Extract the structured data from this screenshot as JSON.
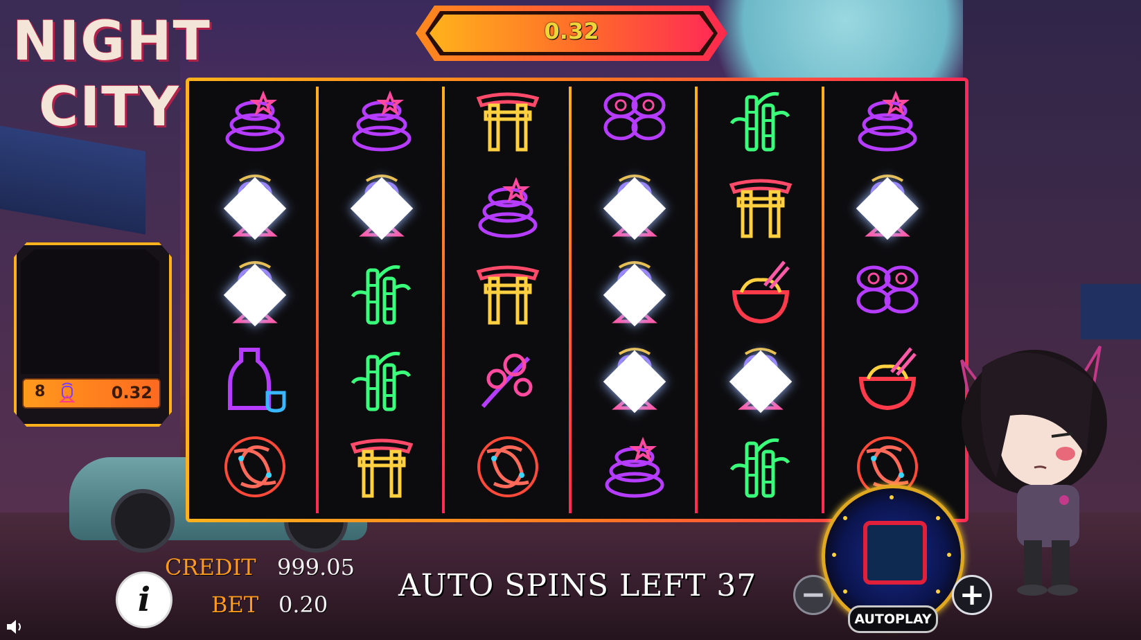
{
  "game": {
    "logo_line1": "NIGHT",
    "logo_line2": "CITY"
  },
  "win_display": {
    "value": "0.32"
  },
  "reels": [
    [
      "stones",
      "lantern",
      "lantern",
      "sake",
      "koi"
    ],
    [
      "stones",
      "lantern",
      "bamboo",
      "bamboo",
      "torii"
    ],
    [
      "torii",
      "stones",
      "torii",
      "blossom",
      "koi"
    ],
    [
      "sushi",
      "lantern",
      "lantern",
      "lantern",
      "stones"
    ],
    [
      "bamboo",
      "torii",
      "noodles",
      "lantern",
      "bamboo"
    ],
    [
      "stones",
      "lantern",
      "sushi",
      "noodles",
      "koi"
    ]
  ],
  "winning_symbol": "lantern",
  "win_summary": {
    "count": "8",
    "symbol": "lantern-icon",
    "amount": "0.32"
  },
  "stats": {
    "credit_label": "CREDIT",
    "credit_value": "999.05",
    "bet_label": "BET",
    "bet_value": "0.20"
  },
  "auto_spins": {
    "text": "AUTO SPINS LEFT 37"
  },
  "controls": {
    "info_label": "i",
    "minus_label": "−",
    "plus_label": "+",
    "autoplay_label": "AUTOPLAY"
  },
  "colors": {
    "frame_start": "#ffb21c",
    "frame_end": "#ff2a55",
    "accent_orange": "#ff9a1d",
    "win_text": "#eed53a"
  }
}
